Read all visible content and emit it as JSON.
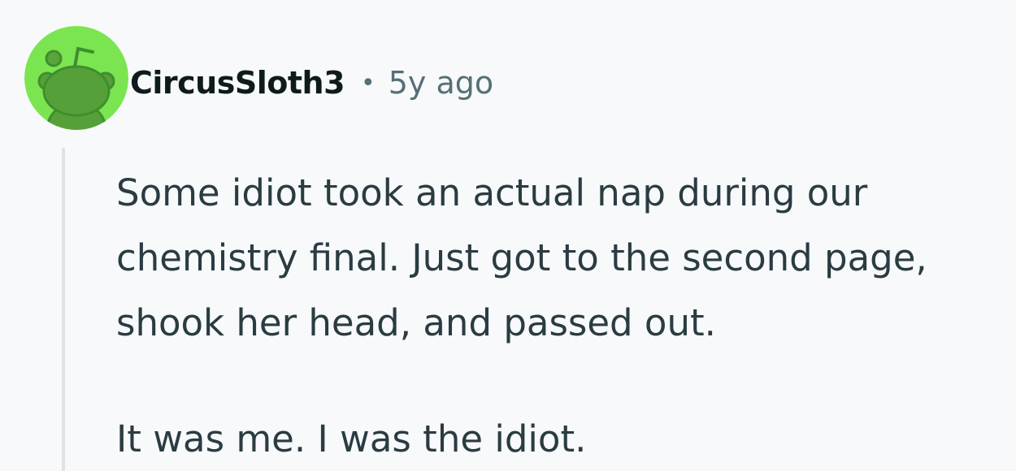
{
  "comment": {
    "avatar_icon": "reddit-snoo-avatar-icon",
    "avatar_color": "#7ae550",
    "username": "CircusSloth3",
    "separator": "•",
    "timestamp": "5y ago",
    "paragraphs": [
      "Some idiot took an actual nap during our chemistry final. Just got to the second page, shook her head, and passed out.",
      "It was me. I was the idiot."
    ]
  }
}
